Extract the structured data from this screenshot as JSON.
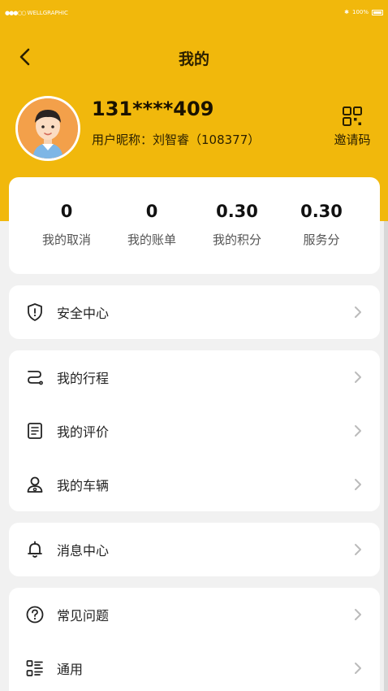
{
  "status_bar": {
    "carrier": "WELLGRAPHIC",
    "battery": "100%"
  },
  "nav": {
    "title": "我的"
  },
  "profile": {
    "phone": "131****409",
    "nickname": "用户昵称：刘智睿（108377）",
    "invite_label": "邀请码"
  },
  "stats": [
    {
      "value": "0",
      "label": "我的取消"
    },
    {
      "value": "0",
      "label": "我的账单"
    },
    {
      "value": "0.30",
      "label": "我的积分"
    },
    {
      "value": "0.30",
      "label": "服务分"
    }
  ],
  "menu": {
    "safety": "安全中心",
    "trips": "我的行程",
    "reviews": "我的评价",
    "vehicles": "我的车辆",
    "messages": "消息中心",
    "faq": "常见问题",
    "general": "通用"
  },
  "colors": {
    "header": "#f1b80c",
    "background": "#f1f1f1",
    "card": "#ffffff"
  }
}
